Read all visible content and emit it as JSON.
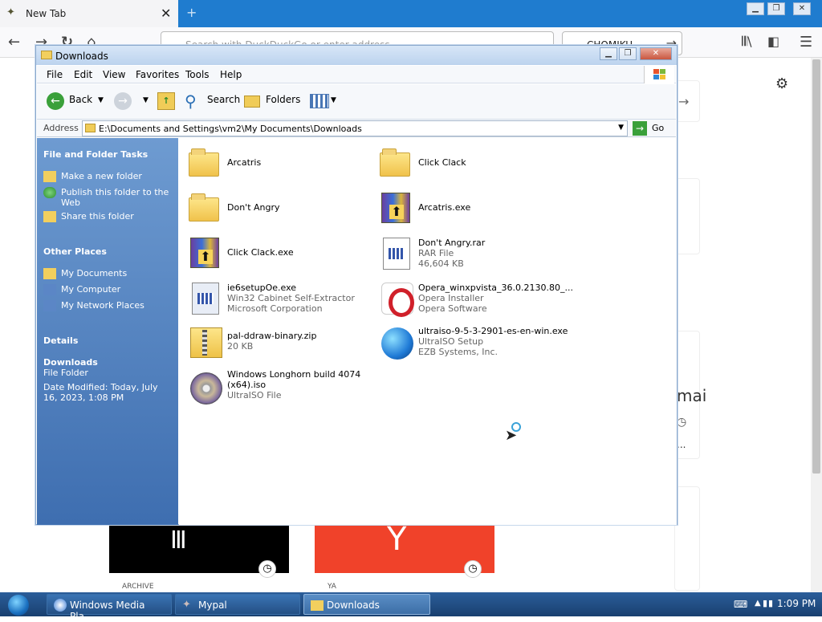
{
  "browser": {
    "tab_title": "New Tab",
    "tab_close": "✕",
    "new_tab": "+",
    "url_placeholder": "Search with DuckDuckGo or enter address",
    "search_value": "CHOMIKU",
    "window_min": "▁",
    "window_restore": "❐",
    "window_close": "✕",
    "partial_text": "mai",
    "partial_dots": "..."
  },
  "tiles": [
    {
      "label": "ARCHIVE"
    },
    {
      "label": "YA"
    }
  ],
  "explorer": {
    "title": "Downloads",
    "menu": [
      "File",
      "Edit",
      "View",
      "Favorites",
      "Tools",
      "Help"
    ],
    "toolbar": {
      "back": "Back",
      "search": "Search",
      "folders": "Folders"
    },
    "address_label": "Address",
    "address_value": "E:\\Documents and Settings\\vm2\\My Documents\\Downloads",
    "go": "Go",
    "tasks": {
      "heading": "File and Folder Tasks",
      "items": [
        "Make a new folder",
        "Publish this folder to the Web",
        "Share this folder"
      ]
    },
    "other_places": {
      "heading": "Other Places",
      "items": [
        "My Documents",
        "My Computer",
        "My Network Places"
      ]
    },
    "details": {
      "heading": "Details",
      "name": "Downloads",
      "type": "File Folder",
      "modified": "Date Modified: Today, July 16, 2023, 1:08 PM"
    },
    "files": [
      {
        "name": "Arcatris",
        "line2": "",
        "line3": "",
        "kind": "folder"
      },
      {
        "name": "Click Clack",
        "line2": "",
        "line3": "",
        "kind": "folder"
      },
      {
        "name": "Don't Angry",
        "line2": "",
        "line3": "",
        "kind": "folder"
      },
      {
        "name": "Arcatris.exe",
        "line2": "",
        "line3": "",
        "kind": "exe"
      },
      {
        "name": "Click Clack.exe",
        "line2": "",
        "line3": "",
        "kind": "exe"
      },
      {
        "name": "Don't Angry.rar",
        "line2": "RAR File",
        "line3": "46,604 KB",
        "kind": "rar"
      },
      {
        "name": "ie6setupOe.exe",
        "line2": "Win32 Cabinet Self-Extractor",
        "line3": "Microsoft Corporation",
        "kind": "setup"
      },
      {
        "name": "Opera_winxpvista_36.0.2130.80_...",
        "line2": "Opera Installer",
        "line3": "Opera Software",
        "kind": "opera"
      },
      {
        "name": "pal-ddraw-binary.zip",
        "line2": "20 KB",
        "line3": "",
        "kind": "zip"
      },
      {
        "name": "ultraiso-9-5-3-2901-es-en-win.exe",
        "line2": "UltraISO Setup",
        "line3": "EZB Systems, Inc.",
        "kind": "globe"
      },
      {
        "name": "Windows Longhorn build 4074 (x64).iso",
        "line2": "UltraISO File",
        "line3": "",
        "kind": "disc"
      }
    ]
  },
  "taskbar": {
    "items": [
      "Windows Media Pla...",
      "Mypal",
      "Downloads"
    ],
    "clock": "1:09 PM"
  }
}
